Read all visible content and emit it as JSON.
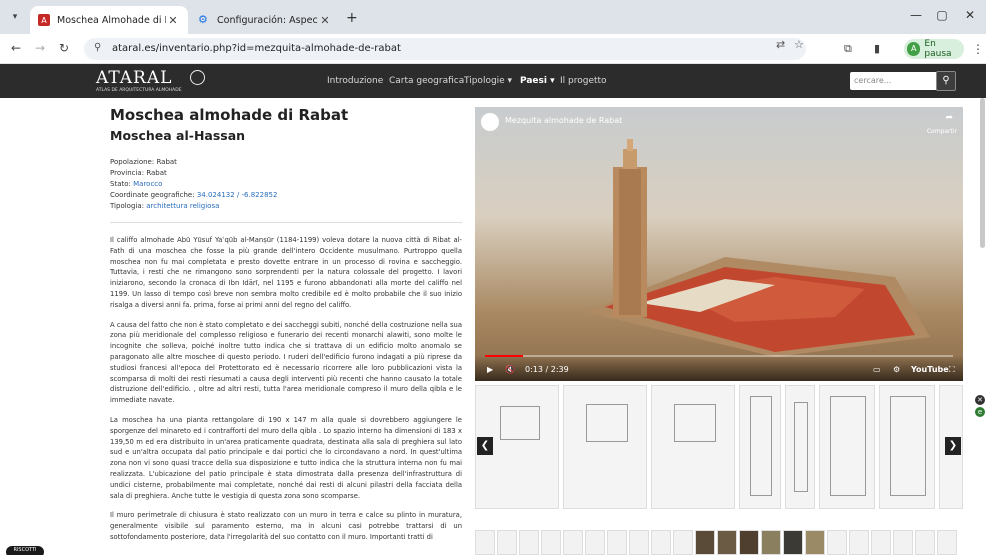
{
  "browser": {
    "tabs": [
      {
        "title": "Moschea Almohade di Rabat - Is",
        "active": true
      },
      {
        "title": "Configuración: Aspecto",
        "active": false
      }
    ],
    "url": "ataral.es/inventario.php?id=mezquita-almohade-de-rabat",
    "profile_label": "En pausa",
    "profile_initial": "A"
  },
  "site": {
    "logo_text": "ATARAL",
    "logo_subtitle": "ATLAS DE ARQUITECTURA ALMOHADE",
    "nav": [
      "Introduzione",
      "Carta geografica",
      "Tipologie ▾",
      "Paesi ▾",
      "Il progetto"
    ],
    "search_placeholder": "cercare..."
  },
  "article": {
    "title": "Moschea almohade di Rabat",
    "subtitle": "Moschea al-Hassan",
    "info": {
      "popolazione_label": "Popolazione:",
      "popolazione": "Rabat",
      "provincia_label": "Provincia:",
      "provincia": "Rabat",
      "stato_label": "Stato:",
      "stato": "Marocco",
      "coord_label": "Coordinate geografiche:",
      "coord_lat": "34.024132",
      "coord_sep": " / ",
      "coord_lon": "-6.822852",
      "tipologia_label": "Tipologia:",
      "tipologia": "architettura religiosa"
    },
    "paragraphs": [
      "Il califfo almohade Abū Yūsuf Yaʿqūb al-Manṣūr (1184-1199) voleva dotare la nuova città di Ribat al-Fath di una moschea che fosse la più grande dell'intero Occidente musulmano. Purtroppo quella moschea non fu mai completata e presto dovette entrare in un processo di rovina e saccheggio. Tuttavia, i resti che ne rimangono sono sorprendenti per la natura colossale del progetto. I lavori iniziarono, secondo la cronaca di Ibn Idārī, nel 1195 e furono abbandonati alla morte del califfo nel 1199. Un lasso di tempo così breve non sembra molto credibile ed è molto probabile che il suo inizio risalga a diversi anni fa. prima, forse ai primi anni del regno del califfo.",
      "A causa del fatto che non è stato completato e dei saccheggi subiti, nonché della costruzione nella sua zona più meridionale del complesso religioso e funerario dei recenti monarchi alawiti, sono molte le incognite che solleva, poiché inoltre tutto indica che si trattava di un edificio molto anomalo se paragonato alle altre moschee di questo periodo. I ruderi dell'edificio furono indagati a più riprese da studiosi francesi all'epoca del Protettorato ed è necessario ricorrere alle loro pubblicazioni vista la scomparsa di molti dei resti riesumati a causa degli interventi più recenti che hanno causato la totale distruzione dell'edificio. , oltre ad altri resti, tutta l'area meridionale compreso il muro della qibla e le immediate navate.",
      "La moschea ha una pianta rettangolare di 190 x 147 m alla quale si dovrebbero aggiungere le sporgenze del minareto ed i contrafforti del muro della qibla . Lo spazio interno ha dimensioni di 183 x 139,50 m ed era distribuito in un'area praticamente quadrata, destinata alla sala di preghiera sul lato sud e un'altra occupata dal patio principale e dai portici che lo circondavano a nord. In quest'ultima zona non vi sono quasi tracce della sua disposizione e tutto indica che la struttura interna non fu mai realizzata. L'ubicazione del patio principale è stata dimostrata dalla presenza dell'infrastruttura di undici cisterne, probabilmente mai completate, nonché dai resti di alcuni pilastri della facciata della sala di preghiera. Anche tutte le vestigia di questa zona sono scomparse.",
      "Il muro perimetrale di chiusura è stato realizzato con un muro in terra e calce su plinto in muratura, generalmente visibile sul paramento esterno, ma in alcuni casi potrebbe trattarsi di un sottofondamento posteriore, data l'irregolarità del suo contatto con il muro. Importanti tratti di"
    ]
  },
  "video": {
    "title": "Mezquita almohade de Rabat",
    "share_label": "Compartir",
    "time": "0:13 / 2:39",
    "progress": 0.082,
    "youtube_label": "YouTube"
  },
  "badge_label": "RISCOTTI",
  "colors": {
    "link": "#2a6ebb",
    "header_bg": "#2c2c2c",
    "profile_bg": "#d7efdc",
    "progress": "#ff0000"
  }
}
